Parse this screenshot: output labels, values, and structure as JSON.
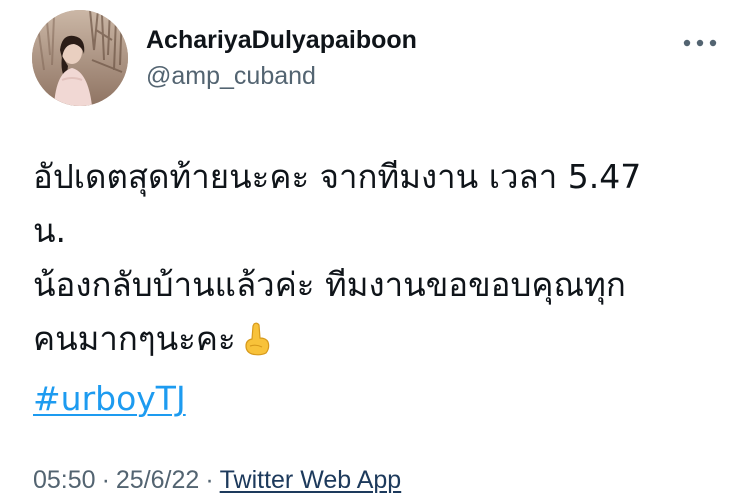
{
  "author": {
    "display_name": "AchariyaDulyapaiboon",
    "handle": "@amp_cuband",
    "avatar_icon": "profile-photo"
  },
  "menu": {
    "icon": "more-icon"
  },
  "tweet": {
    "lines": [
      "อัปเดตสุดท้ายนะคะ จากทีมงาน เวลา 5.47",
      "น.",
      "น้องกลับบ้านแล้วค่ะ ทีมงานขอขอบคุณทุก",
      "คนมากๆนะคะ"
    ],
    "emoji_icon": "pointing-hand-emoji-icon",
    "hashtag": "#urboyTJ"
  },
  "meta": {
    "time": "05:50",
    "date": "25/6/22",
    "separator": "·",
    "source": "Twitter Web App"
  },
  "colors": {
    "text": "#0f1419",
    "secondary": "#536471",
    "link": "#1d9bf0"
  }
}
